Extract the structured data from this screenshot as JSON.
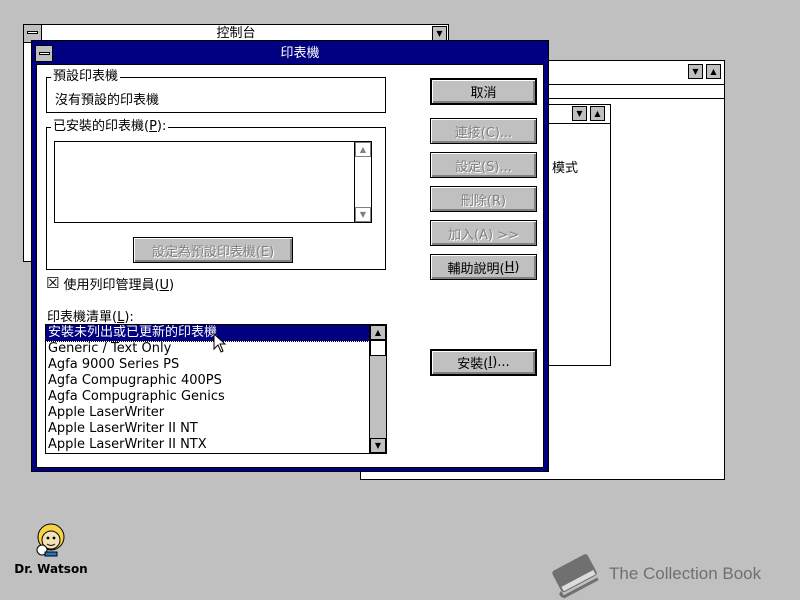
{
  "control_panel": {
    "title": "控制台"
  },
  "back_window": {
    "partial_label": "模式"
  },
  "dialog": {
    "title": "印表機",
    "default_printer": {
      "legend": "預設印表機",
      "value": "沒有預設的印表機"
    },
    "installed": {
      "legend_prefix": "已安裝的印表機(",
      "legend_key": "P",
      "legend_suffix": "):",
      "items": []
    },
    "set_default_button": "設定為預設印表機(E)",
    "print_manager": {
      "checked": true,
      "check_glyph": "☒",
      "label_prefix": "使用列印管理員(",
      "label_key": "U",
      "label_suffix": ")"
    },
    "printer_list": {
      "label_prefix": "印表機清單(",
      "label_key": "L",
      "label_suffix": "):",
      "items": [
        "安裝未列出或已更新的印表機",
        "Generic / Text Only",
        "Agfa 9000 Series PS",
        "Agfa Compugraphic 400PS",
        "Agfa Compugraphic Genics",
        "Apple LaserWriter",
        "Apple LaserWriter II NT",
        "Apple LaserWriter II NTX"
      ],
      "selected_index": 0
    },
    "buttons": {
      "cancel": "取消",
      "connect": "連接(C)...",
      "setup": "設定(S)...",
      "remove": "刪除(R)",
      "add": "加入(A) >>",
      "help_prefix": "輔助說明(",
      "help_key": "H",
      "help_suffix": ")",
      "install_prefix": "安裝(",
      "install_key": "I",
      "install_suffix": ")..."
    }
  },
  "desktop": {
    "icon_label": "Dr. Watson",
    "watermark": "The Collection Book"
  },
  "colors": {
    "desktop": "#c0c0c0",
    "title_active": "#000080",
    "title_inactive": "#ffffff",
    "selection": "#000080"
  }
}
